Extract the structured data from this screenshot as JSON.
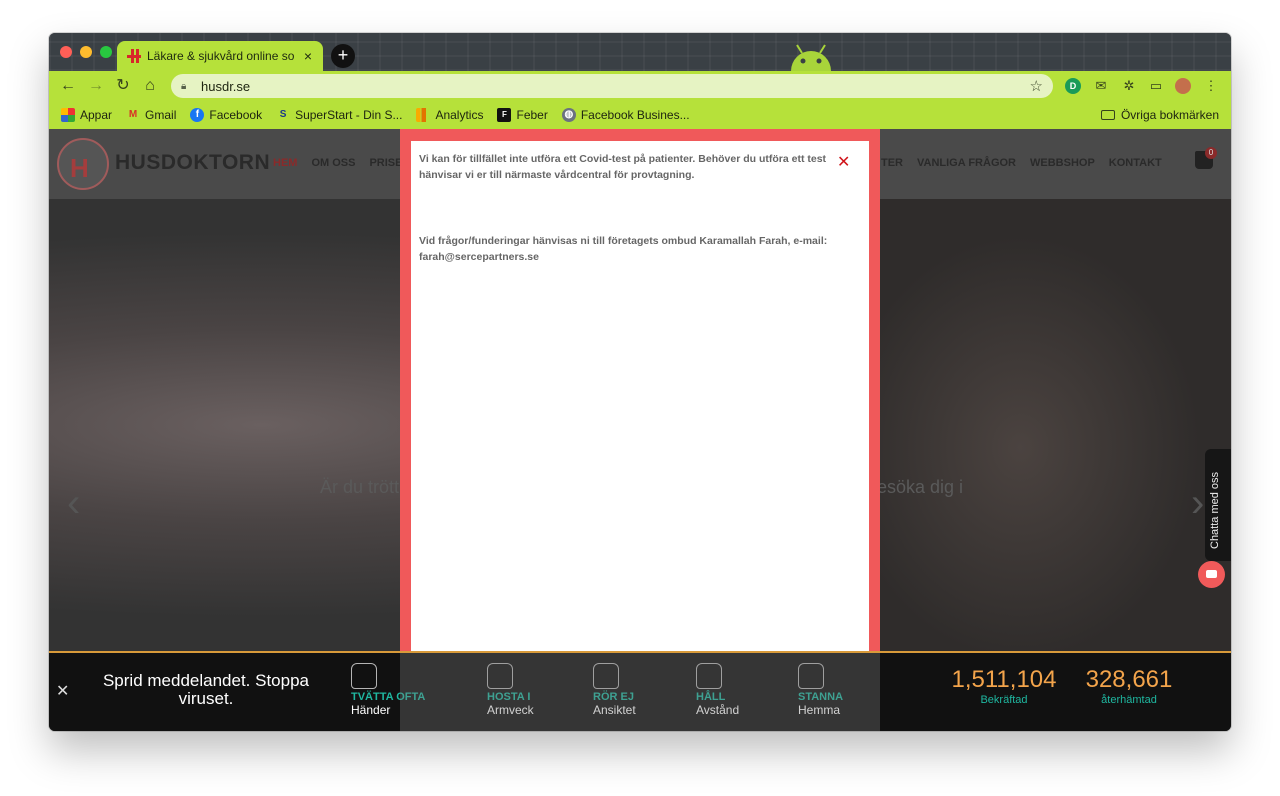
{
  "browser": {
    "tab_title": "Läkare & sjukvård online som ",
    "tab_close": "×",
    "new_tab": "+",
    "url": "husdr.se",
    "star": "☆",
    "bookmarks": [
      {
        "label": "Appar",
        "icon": "apps-grid-icon"
      },
      {
        "label": "Gmail",
        "icon": "gmail-icon"
      },
      {
        "label": "Facebook",
        "icon": "facebook-icon"
      },
      {
        "label": "SuperStart - Din S...",
        "icon": "superstart-icon"
      },
      {
        "label": "Analytics",
        "icon": "analytics-icon"
      },
      {
        "label": "Feber",
        "icon": "feber-icon"
      },
      {
        "label": "Facebook Busines...",
        "icon": "globe-icon"
      }
    ],
    "other_bookmarks": "Övriga bokmärken"
  },
  "site": {
    "logo_text": "HUSDOKTORN",
    "logo_mark": "H",
    "nav_left": [
      "HEM",
      "OM OSS",
      "PRISE"
    ],
    "nav_right": [
      "TER",
      "VANLIGA FRÅGOR",
      "WEBBSHOP",
      "KONTAKT"
    ],
    "cart_count": "0",
    "hero_left": "Är du trött",
    "hero_right": "esöka dig i",
    "prev_arrow": "‹",
    "next_arrow": "›"
  },
  "modal": {
    "paragraph_1": "Vi kan för tillfället inte utföra ett Covid-test på patienter. Behöver du utföra ett test hänvisar vi er till närmaste vårdcentral för provtagning.",
    "paragraph_2": "Vid frågor/funderingar hänvisas ni till företagets ombud Karamallah Farah, e-mail: farah@sercepartners.se",
    "close": "✕"
  },
  "covid_bar": {
    "close": "✕",
    "slogan": "Sprid meddelandet. Stoppa viruset.",
    "tips": [
      {
        "a": "TVÄTTA OFTA",
        "b": "Händer",
        "icon": "hand-wash-icon"
      },
      {
        "a": "HOSTA I",
        "b": "Armveck",
        "icon": "cough-icon"
      },
      {
        "a": "RÖR EJ",
        "b": "Ansiktet",
        "icon": "face-icon"
      },
      {
        "a": "HÅLL",
        "b": "Avstånd",
        "icon": "distance-icon"
      },
      {
        "a": "STANNA",
        "b": "Hemma",
        "icon": "home-icon"
      }
    ],
    "confirmed_number": "1,511,104",
    "confirmed_label": "Bekräftad",
    "recovered_number": "328,661",
    "recovered_label": "återhämtad"
  },
  "chat": {
    "label": "Chatta med oss"
  },
  "colors": {
    "chrome_theme": "#b6e13a",
    "modal_border": "#f0595a",
    "accent_teal": "#1fb7a0",
    "accent_orange": "#f3a44b"
  }
}
